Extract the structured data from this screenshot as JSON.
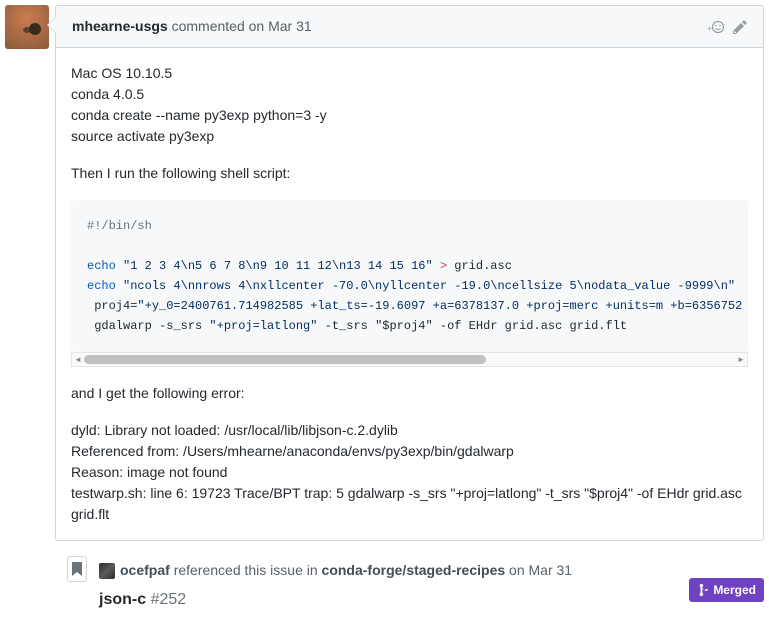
{
  "comment": {
    "author": "mhearne-usgs",
    "action_text": "commented",
    "timestamp": "on Mar 31",
    "body_lines": [
      "Mac OS 10.10.5",
      "conda 4.0.5",
      "conda create --name py3exp python=3 -y",
      "source activate py3exp"
    ],
    "middle_text": "Then I run the following shell script:",
    "code": {
      "shebang": "#!/bin/sh",
      "echo1_cmd": "echo",
      "echo1_str": "\"1 2 3 4\\n5 6 7 8\\n9 10 11 12\\n13 14 15 16\"",
      "echo1_op": ">",
      "echo1_rest": " grid.asc",
      "echo2_cmd": "echo",
      "echo2_str": "\"ncols 4\\nnrows 4\\nxllcenter -70.0\\nyllcenter -19.0\\ncellsize 5\\nodata_value -9999\\n\"",
      "proj_pre": " proj4=",
      "proj_str": "\"+y_0=2400761.714982585 +lat_ts=-19.6097 +a=6378137.0 +proj=merc +units=m +b=6356752",
      "warp_pre": " gdalwarp -s_srs ",
      "warp_str": "\"+proj=latlong\"",
      "warp_post": " -t_srs \"$proj4\" -of EHdr grid.asc grid.flt"
    },
    "after_code_text": "and I get the following error:",
    "error_lines": [
      "dyld: Library not loaded: /usr/local/lib/libjson-c.2.dylib",
      "Referenced from: /Users/mhearne/anaconda/envs/py3exp/bin/gdalwarp",
      "Reason: image not found",
      "testwarp.sh: line 6: 19723 Trace/BPT trap: 5 gdalwarp -s_srs \"+proj=latlong\" -t_srs \"$proj4\" -of EHdr grid.asc grid.flt"
    ]
  },
  "reference": {
    "author": "ocefpaf",
    "action": "referenced this issue in",
    "repo": "conda-forge/staged-recipes",
    "timestamp": "on Mar 31",
    "issue_title": "json-c",
    "issue_number": "#252",
    "merged_label": "Merged"
  }
}
